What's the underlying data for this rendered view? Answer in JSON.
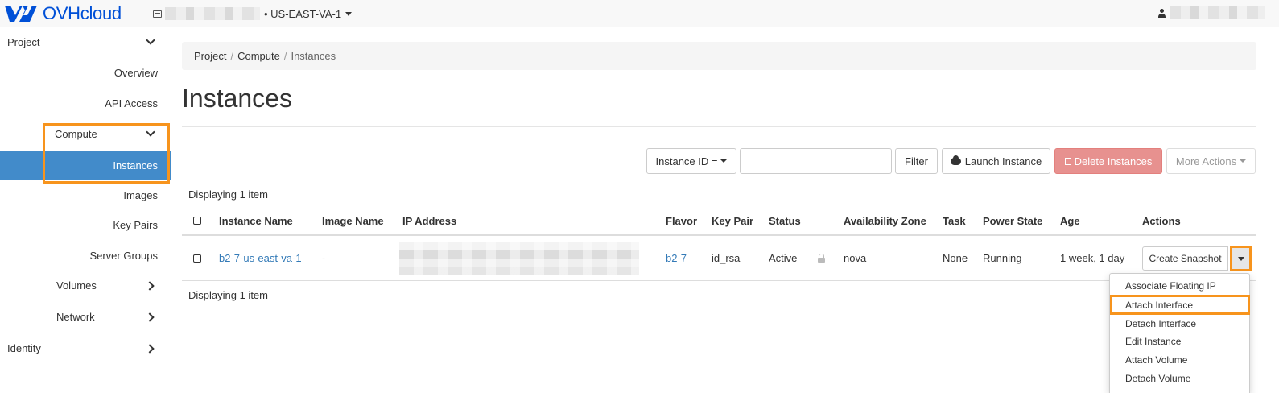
{
  "header": {
    "brand": "OVHcloud",
    "region": "• US-EAST-VA-1",
    "brand_color": "#0050d7"
  },
  "sidebar": {
    "project": "Project",
    "overview": "Overview",
    "api_access": "API Access",
    "compute": "Compute",
    "instances": "Instances",
    "images": "Images",
    "key_pairs": "Key Pairs",
    "server_groups": "Server Groups",
    "volumes": "Volumes",
    "network": "Network",
    "identity": "Identity",
    "active_color": "#428bca",
    "highlight_color": "#f7941d"
  },
  "breadcrumb": {
    "project": "Project",
    "compute": "Compute",
    "current": "Instances",
    "separator": "/"
  },
  "page": {
    "title": "Instances"
  },
  "toolbar": {
    "filter_field": "Instance ID =",
    "filter_value": "",
    "filter_button": "Filter",
    "launch_button": "Launch Instance",
    "delete_button": "Delete Instances",
    "more_actions": "More Actions"
  },
  "table": {
    "count_top": "Displaying 1 item",
    "count_bottom": "Displaying 1 item",
    "columns": {
      "name": "Instance Name",
      "image": "Image Name",
      "ip": "IP Address",
      "flavor": "Flavor",
      "key_pair": "Key Pair",
      "status": "Status",
      "zone": "Availability Zone",
      "task": "Task",
      "power": "Power State",
      "age": "Age",
      "actions": "Actions"
    },
    "rows": [
      {
        "name": "b2-7-us-east-va-1",
        "image": "-",
        "flavor": "b2-7",
        "key_pair": "id_rsa",
        "status": "Active",
        "zone": "nova",
        "task": "None",
        "power": "Running",
        "age": "1 week, 1 day",
        "action": "Create Snapshot"
      }
    ]
  },
  "dropdown": {
    "items": [
      "Associate Floating IP",
      "Attach Interface",
      "Detach Interface",
      "Edit Instance",
      "Attach Volume",
      "Detach Volume"
    ]
  }
}
